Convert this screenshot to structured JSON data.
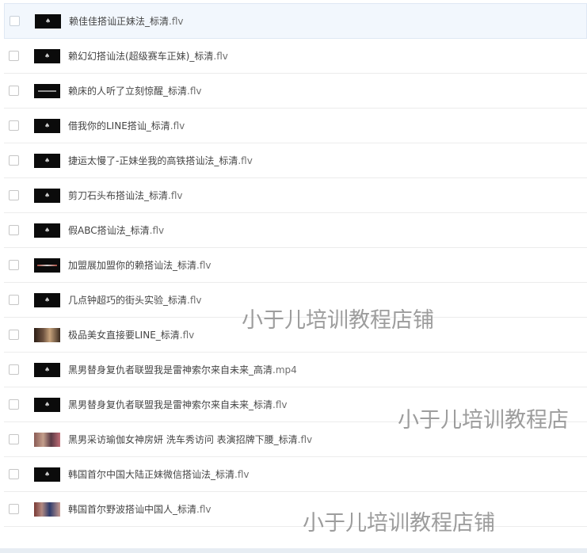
{
  "files": [
    {
      "name": "赖佳佳搭讪正妹法_标清",
      "ext": ".flv",
      "thumb": "dark-logo"
    },
    {
      "name": "赖幻幻搭讪法(超级赛车正妹)_标清",
      "ext": ".flv",
      "thumb": "dark-logo"
    },
    {
      "name": "赖床的人听了立刻惊醒_标清",
      "ext": ".flv",
      "thumb": "dark-text"
    },
    {
      "name": "借我你的LINE搭讪_标清",
      "ext": ".flv",
      "thumb": "dark-logo"
    },
    {
      "name": "捷运太慢了-正妹坐我的高铁搭讪法_标清",
      "ext": ".flv",
      "thumb": "dark-logo"
    },
    {
      "name": "剪刀石头布搭讪法_标清",
      "ext": ".flv",
      "thumb": "dark-logo"
    },
    {
      "name": "假ABC搭讪法_标清",
      "ext": ".flv",
      "thumb": "dark-logo"
    },
    {
      "name": "加盟展加盟你的赖搭讪法_标清",
      "ext": ".flv",
      "thumb": "dark-text-red"
    },
    {
      "name": "几点钟超巧的街头实验_标清",
      "ext": ".flv",
      "thumb": "dark-logo"
    },
    {
      "name": "极品美女直接要LINE_标清",
      "ext": ".flv",
      "thumb": "photo-brown"
    },
    {
      "name": "黑男替身复仇者联盟我是雷神索尔来自未来_高清",
      "ext": ".mp4",
      "thumb": "dark-logo"
    },
    {
      "name": "黑男替身复仇者联盟我是雷神索尔来自未来_标清",
      "ext": ".flv",
      "thumb": "dark-logo"
    },
    {
      "name": "黑男采访瑜伽女神房妍 洗车秀访问 表演招牌下腰_标清",
      "ext": ".flv",
      "thumb": "photo-pink"
    },
    {
      "name": "韩国首尔中国大陆正妹微信搭讪法_标清",
      "ext": ".flv",
      "thumb": "dark-logo"
    },
    {
      "name": "韩国首尔野波搭讪中国人_标清",
      "ext": ".flv",
      "thumb": "photo-street"
    }
  ],
  "watermarks": [
    "小于儿培训教程店铺",
    "小于儿培训教程店",
    "小于儿培训教程店铺"
  ]
}
